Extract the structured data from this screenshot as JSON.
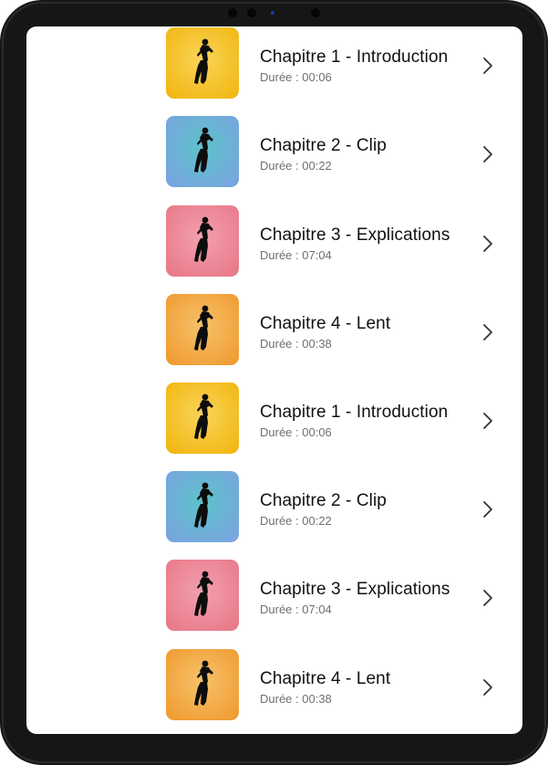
{
  "chapters": [
    {
      "title": "Chapitre 1 - Introduction",
      "duration": "Durée : 00:06",
      "thumb_color": "#f2b60f",
      "thumb_light": "#f9d45a",
      "icon": "dancer-silhouette-icon"
    },
    {
      "title": "Chapitre 2 - Clip",
      "duration": "Durée : 00:22",
      "thumb_color": "#7aa3e0",
      "thumb_light": "#5cc3c9",
      "icon": "dancer-silhouette-icon"
    },
    {
      "title": "Chapitre 3 - Explications",
      "duration": "Durée : 07:04",
      "thumb_color": "#e87888",
      "thumb_light": "#f2a0ae",
      "icon": "dancer-silhouette-icon"
    },
    {
      "title": "Chapitre 4 - Lent",
      "duration": "Durée : 00:38",
      "thumb_color": "#ef9a30",
      "thumb_light": "#f7c26a",
      "icon": "dancer-silhouette-icon"
    },
    {
      "title": "Chapitre 1 - Introduction",
      "duration": "Durée : 00:06",
      "thumb_color": "#f2b60f",
      "thumb_light": "#f9d45a",
      "icon": "dancer-silhouette-icon"
    },
    {
      "title": "Chapitre 2 - Clip",
      "duration": "Durée : 00:22",
      "thumb_color": "#7aa3e0",
      "thumb_light": "#5cc3c9",
      "icon": "dancer-silhouette-icon"
    },
    {
      "title": "Chapitre 3 - Explications",
      "duration": "Durée : 07:04",
      "thumb_color": "#e87888",
      "thumb_light": "#f2a0ae",
      "icon": "dancer-silhouette-icon"
    },
    {
      "title": "Chapitre 4 - Lent",
      "duration": "Durée : 00:38",
      "thumb_color": "#ef9a30",
      "thumb_light": "#f7c26a",
      "icon": "dancer-silhouette-icon"
    }
  ],
  "chevron_icon": "chevron-right-icon",
  "colors": {
    "device_frame": "#161616",
    "title_text": "#111111",
    "duration_text": "#6f6f6f",
    "chevron": "#333333"
  }
}
